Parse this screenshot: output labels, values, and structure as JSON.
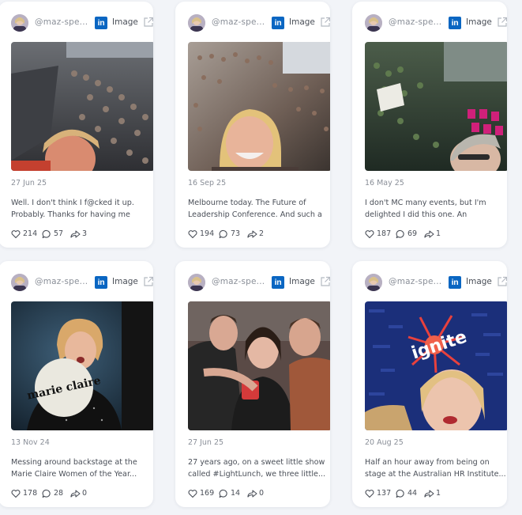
{
  "posts": [
    {
      "handle": "@maz-spe...",
      "type_label": "Image",
      "date": "27 Jun 25",
      "caption": "Well. I don't think I f@cked it up. Probably. Thanks for having me Rory...",
      "likes": "214",
      "comments": "57",
      "shares": "3"
    },
    {
      "handle": "@maz-spe...",
      "type_label": "Image",
      "date": "16 Sep 25",
      "caption": "Melbourne today. The Future of Leadership Conference. And such a jo...",
      "likes": "194",
      "comments": "73",
      "shares": "2"
    },
    {
      "handle": "@maz-spe...",
      "type_label": "Image",
      "date": "16 May 25",
      "caption": "I don't MC many events, but I'm delighted I did this one. An incredible...",
      "likes": "187",
      "comments": "69",
      "shares": "1"
    },
    {
      "handle": "@maz-spe...",
      "type_label": "Image",
      "date": "13 Nov 24",
      "caption": "Messing around backstage at the Marie Claire Women of the Year...",
      "likes": "178",
      "comments": "28",
      "shares": "0",
      "photo_text": "marie claire"
    },
    {
      "handle": "@maz-spe...",
      "type_label": "Image",
      "date": "27 Jun 25",
      "caption": "27 years ago, on a sweet little show called #LightLunch, we three little...",
      "likes": "169",
      "comments": "14",
      "shares": "0"
    },
    {
      "handle": "@maz-spe...",
      "type_label": "Image",
      "date": "20 Aug 25",
      "caption": "Half an hour away from being on stage at the Australian HR Institute...",
      "likes": "137",
      "comments": "44",
      "shares": "1",
      "photo_text": "ignite"
    }
  ],
  "platform_badge": "in",
  "icons": {
    "avatar": "profile-avatar",
    "platform": "linkedin-icon",
    "external": "external-link-icon",
    "likes": "heart-icon",
    "comments": "comment-icon",
    "shares": "share-icon"
  },
  "colors": {
    "linkedin": "#0a66c2",
    "card_bg": "#ffffff",
    "page_bg": "#f2f4f8",
    "muted_text": "#8a8f98",
    "body_text": "#4a4f58"
  }
}
